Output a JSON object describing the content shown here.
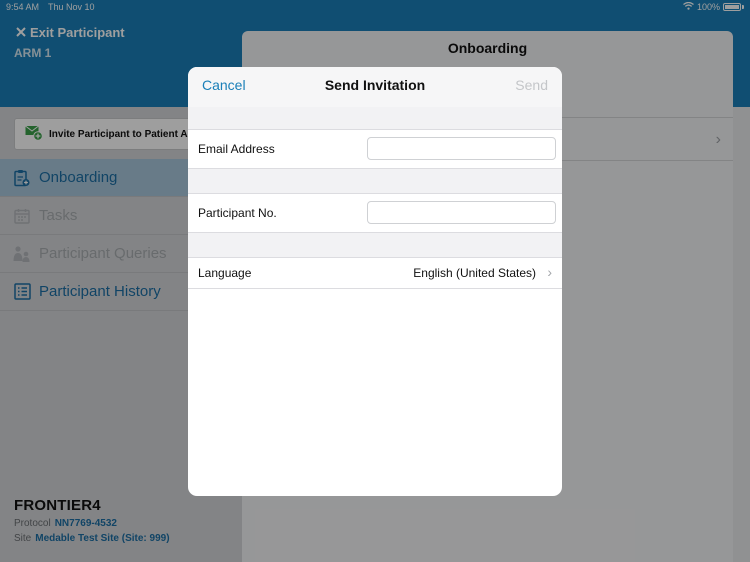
{
  "status": {
    "time": "9:54 AM",
    "date": "Thu Nov 10",
    "battery": "100%"
  },
  "header": {
    "exit_label": "Exit Participant",
    "arm": "ARM 1"
  },
  "sidebar": {
    "invite_label": "Invite Participant to Patient App",
    "items": [
      {
        "label": "Onboarding",
        "state": "active"
      },
      {
        "label": "Tasks",
        "state": "disabled"
      },
      {
        "label": "Participant Queries",
        "state": "disabled"
      },
      {
        "label": "Participant History",
        "state": "link"
      }
    ]
  },
  "study": {
    "name": "FRONTIER4",
    "protocol_label": "Protocol",
    "protocol_value": "NN7769-4532",
    "site_label": "Site",
    "site_value": "Medable Test Site (Site: 999)"
  },
  "content": {
    "title": "Onboarding"
  },
  "modal": {
    "cancel_label": "Cancel",
    "title": "Send Invitation",
    "send_label": "Send",
    "email_label": "Email Address",
    "email_value": "",
    "participant_label": "Participant No.",
    "participant_value": "",
    "language_label": "Language",
    "language_value": "English (United States)"
  },
  "colors": {
    "brand": "#1a7fb8",
    "accent_link": "#1c6fa5",
    "disabled": "#c4c6c9"
  },
  "icons": [
    "wifi-icon",
    "battery-icon",
    "close-icon",
    "invite-mail-icon",
    "onboarding-icon",
    "tasks-icon",
    "queries-icon",
    "history-icon",
    "chevron-right-icon"
  ]
}
